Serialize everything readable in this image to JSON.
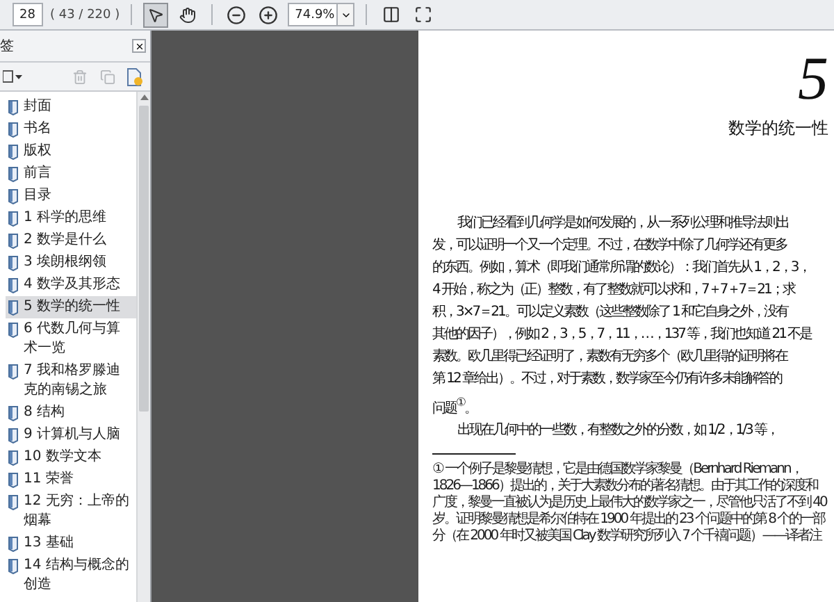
{
  "toolbar": {
    "page_field": {
      "value": "28"
    },
    "page_count": "( 43 / 220 )",
    "tools": [
      {
        "kind": "select",
        "selected": true
      },
      {
        "kind": "hand",
        "selected": false
      }
    ],
    "zoom_field": {
      "value": "74.9%"
    }
  },
  "sidebar": {
    "title": "签",
    "items": [
      {
        "label": "封面",
        "selected": false
      },
      {
        "label": "书名",
        "selected": false
      },
      {
        "label": "版权",
        "selected": false
      },
      {
        "label": "前言",
        "selected": false
      },
      {
        "label": "目录",
        "selected": false
      },
      {
        "label": "1 科学的思维",
        "selected": false
      },
      {
        "label": "2 数学是什么",
        "selected": false
      },
      {
        "label": "3 埃朗根纲领",
        "selected": false
      },
      {
        "label": "4 数学及其形态",
        "selected": false
      },
      {
        "label": "5 数学的统一性",
        "selected": true
      },
      {
        "label": "6 代数几何与算术一览",
        "selected": false
      },
      {
        "label": "7 我和格罗滕迪克的南锡之旅",
        "selected": false
      },
      {
        "label": "8 结构",
        "selected": false
      },
      {
        "label": "9 计算机与人脑",
        "selected": false
      },
      {
        "label": "10 数学文本",
        "selected": false
      },
      {
        "label": "11 荣誉",
        "selected": false
      },
      {
        "label": "12 无穷：上帝的烟幕",
        "selected": false
      },
      {
        "label": "13 基础",
        "selected": false
      },
      {
        "label": "14 结构与概念的创造",
        "selected": false
      }
    ]
  },
  "page": {
    "chapter_number": "5",
    "chapter_title": "数学的统一性",
    "lines": [
      {
        "text": "我们已经看到几何学是如何发展的，从一系列公理和推导法则出",
        "indent": true
      },
      {
        "text": "发，可以证明一个又一个定理。不过，在数学中除了几何学还有更多",
        "indent": false
      },
      {
        "text": "的东西。例如，算术（即我们通常所谓的数论）：我们首先从 1，2，3，",
        "indent": false
      },
      {
        "text": "4 开始，称之为（正）整数，有了整数就可以求和，7＋7＋7＝21；求",
        "indent": false
      },
      {
        "text": "积，3×7＝21。可以定义素数（这些整数除了 1 和它自身之外，没有",
        "indent": false
      },
      {
        "text": "其他的因子），例如 2，3，5，7，11，…，137 等，我们也知道 21 不是",
        "indent": false
      },
      {
        "text": "素数。欧几里得已经证明了，素数有无穷多个（欧几里得的证明将在",
        "indent": false
      },
      {
        "text": "第 12 章给出）。不过，对于素数，数学家至今仍有许多未能解答的",
        "indent": false
      },
      {
        "text": "问题$^{①}$。",
        "indent": false
      },
      {
        "text": "出现在几何中的一些数，有整数之外的分数，如 1/2，1/3 等，",
        "indent": true
      }
    ],
    "footnote": "① 一个例子是黎曼猜想，它是由德国数学家黎曼（Bernhard Riemann，1826—1866）提出的，关于大素数分布的著名猜想。由于其工作的深度和广度，黎曼一直被认为是历史上最伟大的数学家之一，尽管他只活了不到 40 岁。证明黎曼猜想是希尔伯特在 1900 年提出的 23 个问题中的第 8 个的一部分（在 2000 年时又被美国 Clay 数学研究所列入 7 个千禧问题）——译者注"
  }
}
